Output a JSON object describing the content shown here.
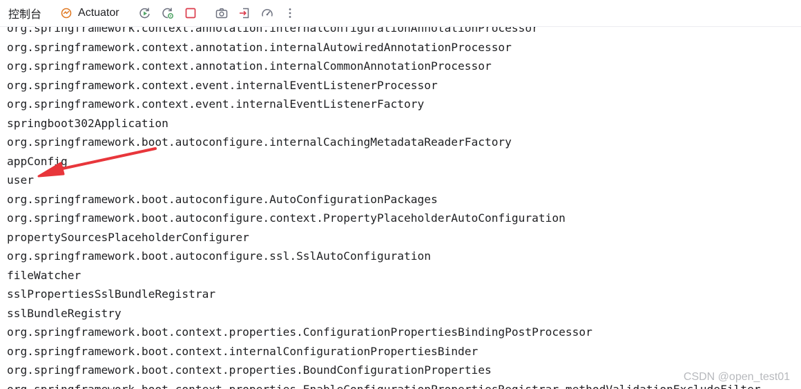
{
  "toolbar": {
    "tabs": [
      {
        "label": "控制台"
      },
      {
        "label": "Actuator"
      }
    ],
    "accent_color": "#e07a24"
  },
  "console": {
    "lines": [
      "org.springframework.context.annotation.internalConfigurationAnnotationProcessor",
      "org.springframework.context.annotation.internalAutowiredAnnotationProcessor",
      "org.springframework.context.annotation.internalCommonAnnotationProcessor",
      "org.springframework.context.event.internalEventListenerProcessor",
      "org.springframework.context.event.internalEventListenerFactory",
      "springboot302Application",
      "org.springframework.boot.autoconfigure.internalCachingMetadataReaderFactory",
      "appConfig",
      "user",
      "org.springframework.boot.autoconfigure.AutoConfigurationPackages",
      "org.springframework.boot.autoconfigure.context.PropertyPlaceholderAutoConfiguration",
      "propertySourcesPlaceholderConfigurer",
      "org.springframework.boot.autoconfigure.ssl.SslAutoConfiguration",
      "fileWatcher",
      "sslPropertiesSslBundleRegistrar",
      "sslBundleRegistry",
      "org.springframework.boot.context.properties.ConfigurationPropertiesBindingPostProcessor",
      "org.springframework.boot.context.internalConfigurationPropertiesBinder",
      "org.springframework.boot.context.properties.BoundConfigurationProperties",
      "org.springframework.boot.context.properties.EnableConfigurationPropertiesRegistrar.methodValidationExcludeFilter"
    ],
    "annotation_arrow_color": "#e8363b"
  },
  "watermark": "CSDN @open_test01"
}
